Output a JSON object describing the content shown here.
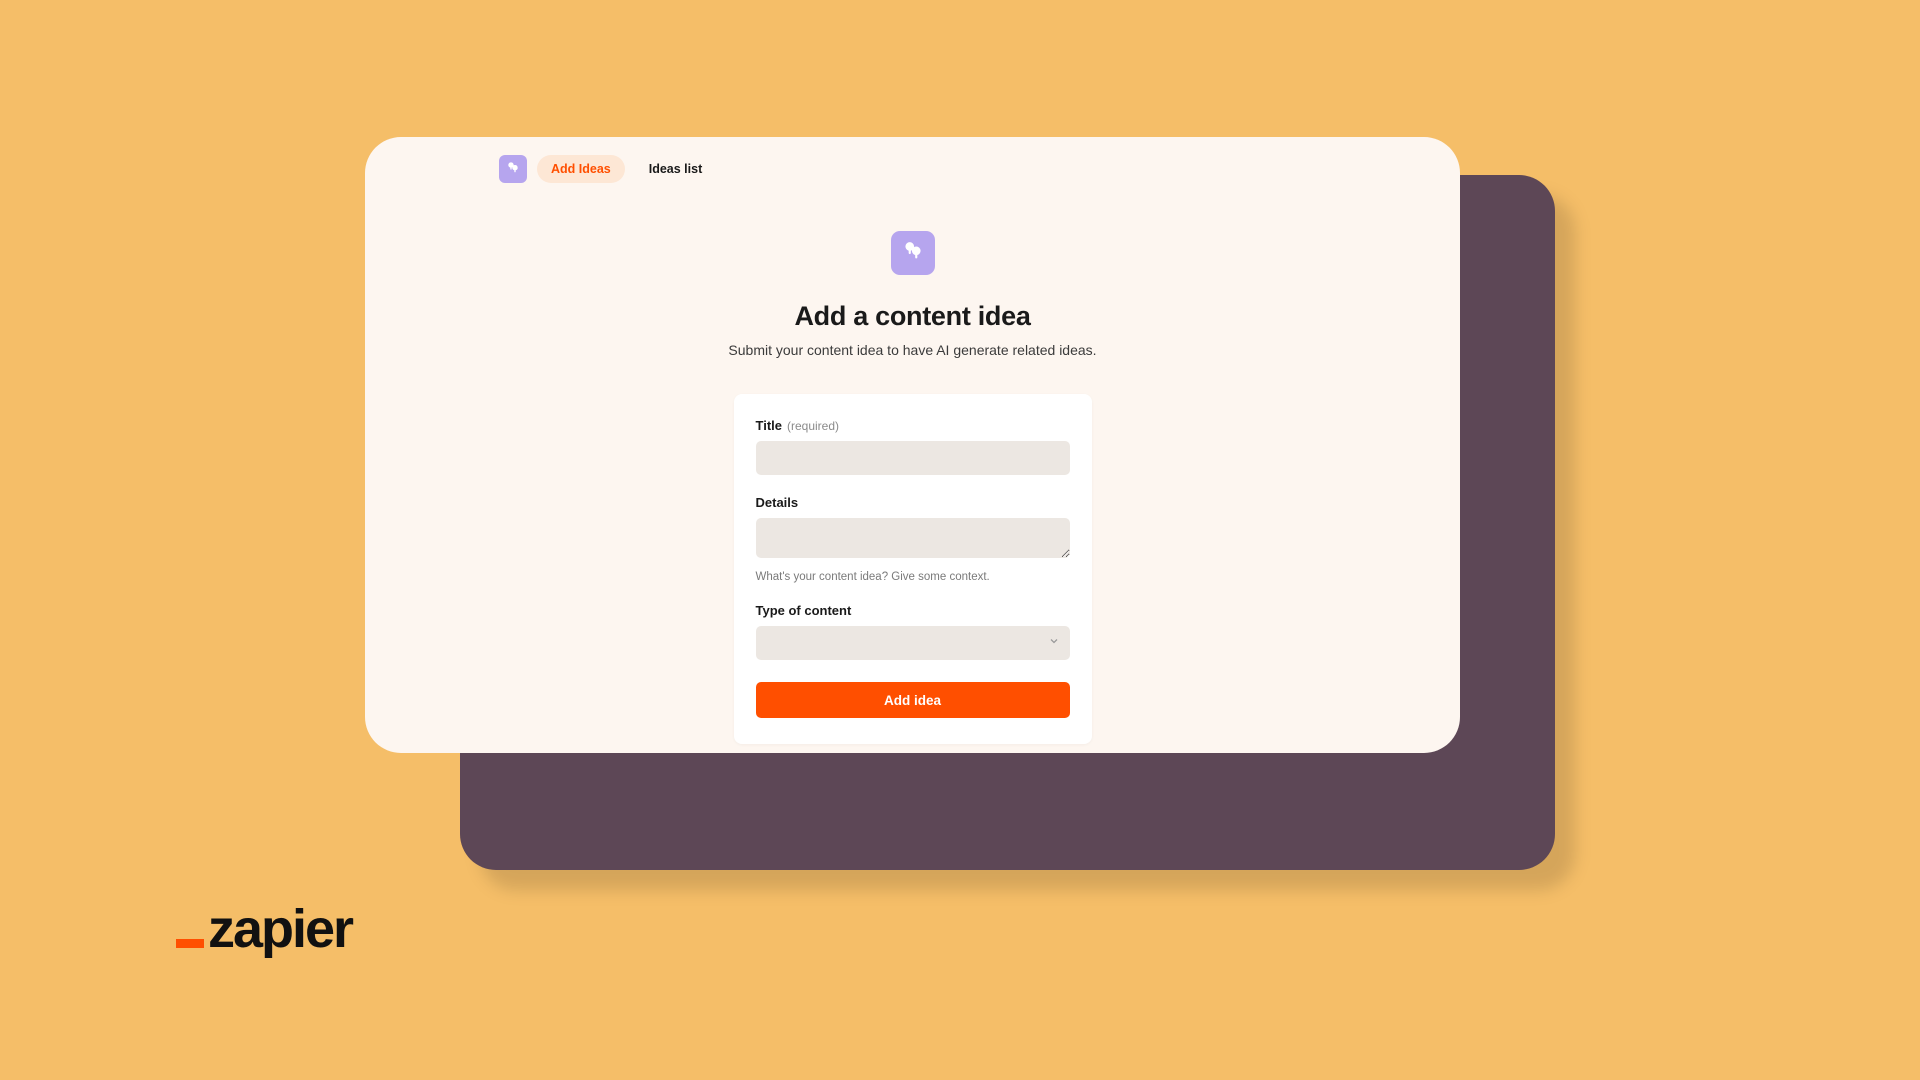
{
  "nav": {
    "tabs": [
      {
        "label": "Add Ideas",
        "active": true
      },
      {
        "label": "Ideas list",
        "active": false
      }
    ]
  },
  "hero": {
    "title": "Add a content idea",
    "subtitle": "Submit your content idea to have AI generate related ideas."
  },
  "form": {
    "title": {
      "label": "Title",
      "hint": "(required)",
      "value": ""
    },
    "details": {
      "label": "Details",
      "value": "",
      "help": "What's your content idea? Give some context."
    },
    "type": {
      "label": "Type of content",
      "value": ""
    },
    "submit": "Add idea"
  },
  "brand": {
    "name": "zapier"
  },
  "colors": {
    "accent": "#ff4f00",
    "icon_bg": "#b6a5ee",
    "page_bg": "#f5be68"
  }
}
